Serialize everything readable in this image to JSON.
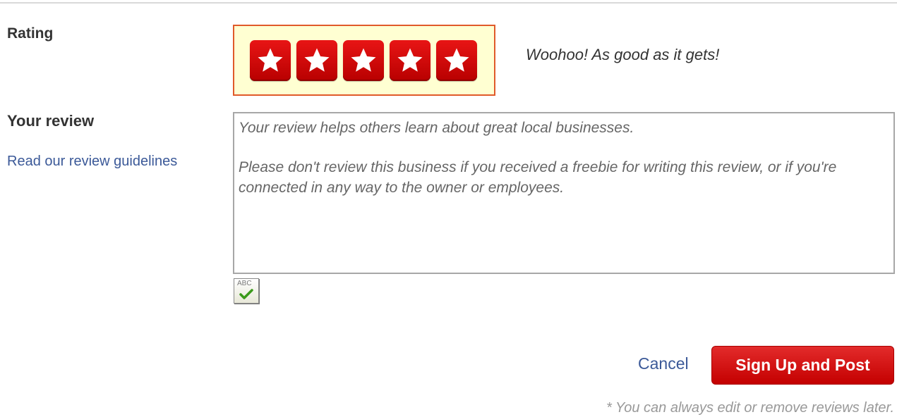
{
  "rating": {
    "label": "Rating",
    "stars": [
      {
        "name": "star-1",
        "filled": true
      },
      {
        "name": "star-2",
        "filled": true
      },
      {
        "name": "star-3",
        "filled": true
      },
      {
        "name": "star-4",
        "filled": true
      },
      {
        "name": "star-5",
        "filled": true
      }
    ],
    "selected": 5,
    "max": 5,
    "caption": "Woohoo! As good as it gets!",
    "star_color": "#d40000",
    "box_background": "#ffffd2",
    "box_border": "#e05a2a"
  },
  "review": {
    "label": "Your review",
    "guidelines_link": "Read our review guidelines",
    "placeholder_line1": "Your review helps others learn about great local businesses.",
    "placeholder_line2": "Please don't review this business if you received a freebie for writing this review, or if you're connected in any way to the owner or employees.",
    "spellcheck_icon": "spellcheck-icon",
    "spellcheck_text": "ABC"
  },
  "actions": {
    "cancel_label": "Cancel",
    "submit_label": "Sign Up and Post",
    "submit_color": "#d00000",
    "link_color": "#3b5998"
  },
  "footnote": "* You can always edit or remove reviews later."
}
